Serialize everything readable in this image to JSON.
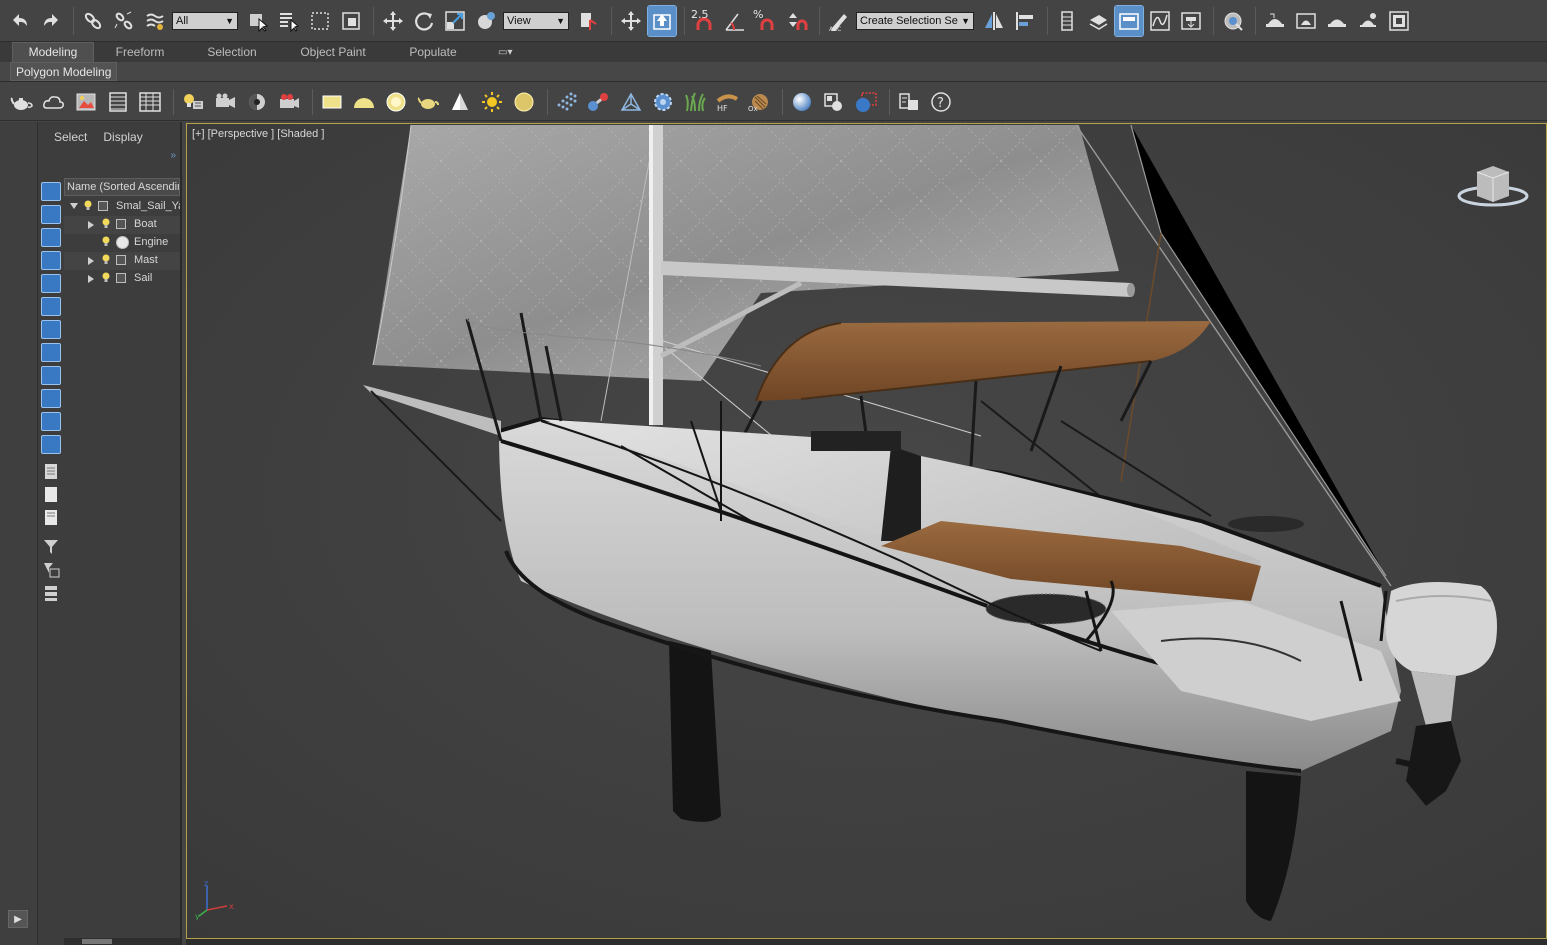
{
  "toolbar": {
    "selection_filter": "All",
    "ref_coord_system": "View",
    "angle_snap": "2.5",
    "percent_snap": "%",
    "named_selection_placeholder": "Create Selection Se",
    "icons": [
      "undo-icon",
      "redo-icon",
      "link-icon",
      "unlink-icon",
      "bind-space-warp-icon",
      "select-object-icon",
      "select-by-name-icon",
      "rect-region-icon",
      "window-crossing-icon",
      "move-icon",
      "rotate-icon",
      "scale-icon",
      "placement-icon",
      "pivot-icon",
      "manipulate-icon",
      "snap-icon",
      "angle-snap-icon",
      "percent-snap-icon",
      "spinner-snap-icon",
      "edit-named-sel-icon",
      "mirror-icon",
      "align-icon",
      "layers-icon",
      "scene-explorer-icon",
      "toggle-ribbon-icon",
      "curve-editor-icon",
      "schematic-view-icon",
      "material-editor-icon",
      "render-setup-icon",
      "render-frame-icon",
      "render-icon",
      "render-cloud-icon",
      "render-iterative-icon"
    ]
  },
  "ribbon": {
    "tabs": [
      "Modeling",
      "Freeform",
      "Selection",
      "Object Paint",
      "Populate"
    ],
    "active_tab": "Modeling",
    "panel_label": "Polygon Modeling"
  },
  "create_toolbar": {
    "icons": [
      "teapot-icon",
      "cloud-icon",
      "picture-icon",
      "grid-icon",
      "grid2-icon",
      "light-bulb-icon",
      "camera-icon",
      "camera2-icon",
      "camera3-icon",
      "plane-light-icon",
      "dome-light-icon",
      "sphere-light-icon",
      "teapot-light-icon",
      "cone-icon",
      "sun-icon",
      "disc-light-icon",
      "particles-icon",
      "molecule-icon",
      "tripod-icon",
      "gear-icon",
      "grass-icon",
      "hair-icon",
      "fur-icon",
      "sphere-icon",
      "render-region-icon",
      "material-sphere-icon",
      "asset-icon",
      "help-icon"
    ]
  },
  "scene_explorer": {
    "tabs": [
      "Select",
      "Display"
    ],
    "header": "Name (Sorted Ascending)",
    "rows": [
      {
        "label": "Smal_Sail_Yacht",
        "level": 0,
        "expanded": true
      },
      {
        "label": "Boat",
        "level": 1,
        "expanded": false
      },
      {
        "label": "Engine",
        "level": 1,
        "expanded": null
      },
      {
        "label": "Mast",
        "level": 1,
        "expanded": false
      },
      {
        "label": "Sail",
        "level": 1,
        "expanded": false
      }
    ]
  },
  "viewport": {
    "label": "[+] [Perspective ] [Shaded ]",
    "border_color": "#b8a04a"
  },
  "colors": {
    "ui_bg": "#444444",
    "accent": "#5b8fc7",
    "canvas_fabric": "#8b5a32"
  }
}
